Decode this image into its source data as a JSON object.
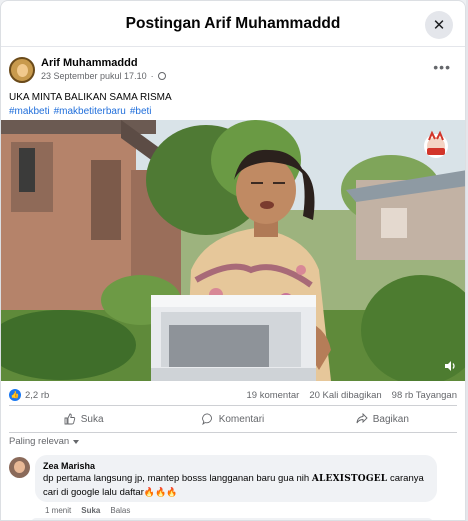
{
  "modal": {
    "title": "Postingan Arif Muhammaddd",
    "close_icon": "close-icon"
  },
  "post": {
    "author": "Arif Muhammaddd",
    "timestamp": "23 September pukul 17.10",
    "audience_icon": "globe-icon",
    "more_icon": "more-icon",
    "text": "UKA MINTA BALIKAN SAMA RISMA",
    "hashtags": [
      "#makbeti",
      "#makbetiterbaru",
      "#beti"
    ]
  },
  "stats": {
    "reactions": "2,2 rb",
    "comments": "19 komentar",
    "shares": "20 Kali dibagikan",
    "views": "98 rb Tayangan"
  },
  "actions": {
    "like": "Suka",
    "comment": "Komentari",
    "share": "Bagikan"
  },
  "comments_section": {
    "sort_label": "Paling relevan",
    "items": [
      {
        "name": "Zea Marisha",
        "text_before": "dp pertama langsung jp, mantep bosss langganan baru gua nih ",
        "brand": "ALEXISTOGEL",
        "text_after": " caranya cari di google lalu daftar",
        "emoji": "🔥🔥🔥",
        "time": "1 menit",
        "like": "Suka",
        "reply": "Balas"
      }
    ]
  },
  "colors": {
    "accent": "#1877f2",
    "link": "#216fdb",
    "muted": "#65676b"
  }
}
